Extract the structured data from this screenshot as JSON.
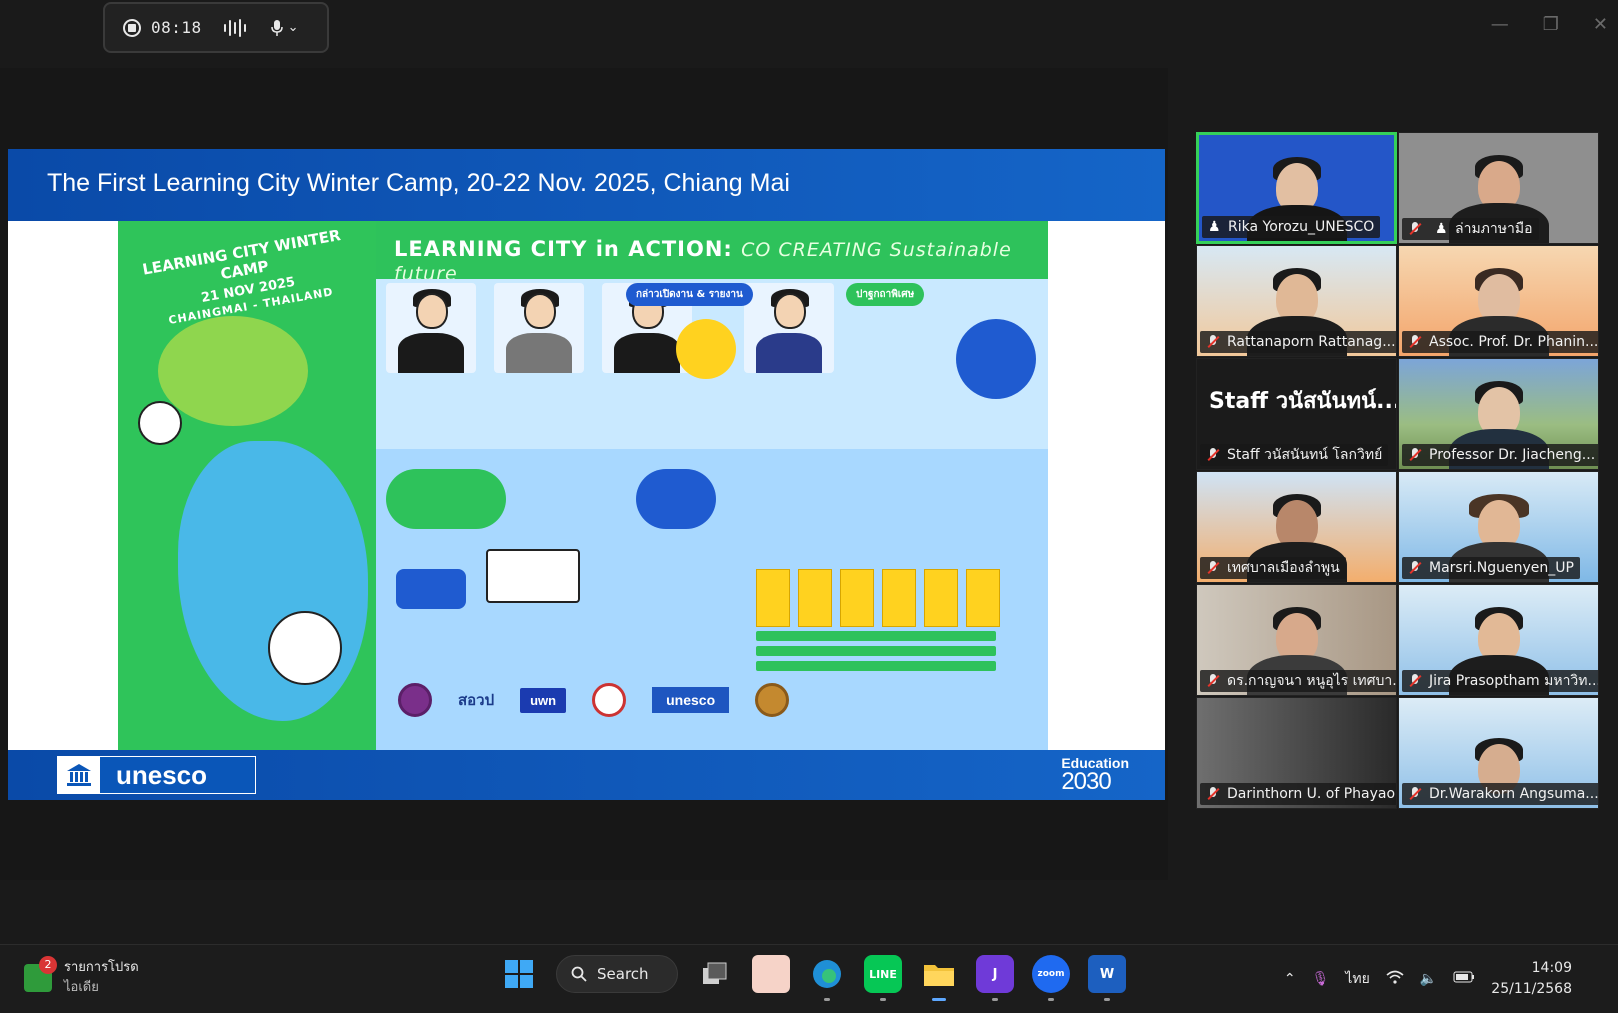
{
  "recording": {
    "time": "08:18"
  },
  "slide": {
    "title": "The First Learning City Winter Camp, 20-22 Nov. 2025, Chiang Mai",
    "footer_logo_text": "unesco",
    "footer_right_line1": "Education",
    "footer_right_line2": "2030"
  },
  "poster": {
    "banner_main": "LEARNING CITY in ACTION:",
    "banner_sub": "CO CREATING Sustainable future",
    "camp_line1": "LEARNING CITY WINTER CAMP",
    "camp_line2": "21 NOV 2025",
    "camp_line3": "CHAINGMAI - THAILAND",
    "pill_opening": "กล่าวเปิดงาน & รายงาน",
    "pill_special": "ปาฐกถาพิเศษ",
    "logo_swu": "สอวป",
    "logo_uwn": "uwn",
    "logo_unesco": "unesco"
  },
  "gallery": {
    "tiles": [
      {
        "name": "Rika Yorozu_UNESCO",
        "active": true,
        "icon": "interpretation-icon"
      },
      {
        "name": "ล่ามภาษามือ",
        "active": false,
        "icon": "interpretation-icon"
      },
      {
        "name": "Rattanaporn Rattanag...",
        "active": false,
        "icon": "mic-muted-icon"
      },
      {
        "name": "Assoc. Prof. Dr. Phanin...",
        "active": false,
        "icon": "mic-muted-icon"
      },
      {
        "name": "Staff วนัสนันทน์ โลกวิทย์",
        "big_name": "Staff วนัสนันทน์...",
        "active": false,
        "icon": "mic-muted-icon"
      },
      {
        "name": "Professor Dr. Jiacheng...",
        "active": false,
        "icon": "mic-muted-icon"
      },
      {
        "name": "เทศบาลเมืองลำพูน",
        "active": false,
        "icon": "mic-muted-icon"
      },
      {
        "name": "Marsri.Nguenyen_UP",
        "active": false,
        "icon": "mic-muted-icon"
      },
      {
        "name": "ดร.กาญจนา หนูอุไร เทศบา...",
        "active": false,
        "icon": "mic-muted-icon"
      },
      {
        "name": "Jira Prasoptham มหาวิท...",
        "active": false,
        "icon": "mic-muted-icon"
      },
      {
        "name": "Darinthorn U. of Phayao",
        "active": false,
        "icon": "mic-muted-icon"
      },
      {
        "name": "Dr.Warakorn Angsuma...",
        "active": false,
        "icon": "mic-muted-icon"
      }
    ]
  },
  "taskbar": {
    "weather_badge": "2",
    "weather_line1": "รายการโปรด",
    "weather_line2": "ไอเดีย",
    "search_label": "Search",
    "line_label": "LINE",
    "zoom_label": "zoom",
    "language": "ไทย",
    "time": "14:09",
    "date": "25/11/2568"
  }
}
